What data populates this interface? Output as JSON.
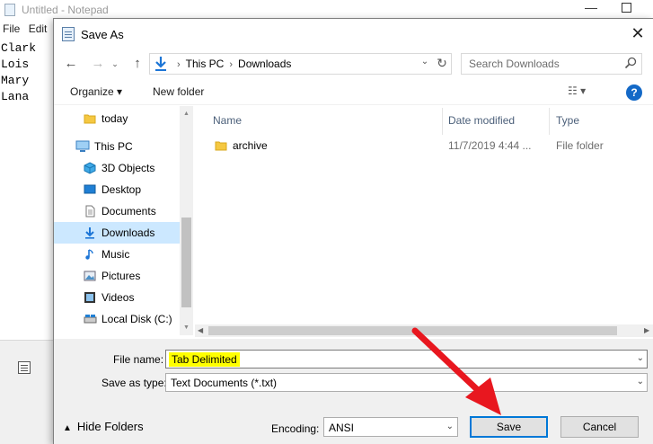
{
  "notepad": {
    "title": "Untitled - Notepad",
    "menu": [
      "File",
      "Edit"
    ],
    "content_lines": [
      "Clark",
      "Lois",
      "Mary",
      "Lana"
    ],
    "min_glyph": "—"
  },
  "dialog": {
    "title": "Save As",
    "close_glyph": "✕",
    "nav": {
      "back_glyph": "←",
      "forward_glyph": "→",
      "recent_glyph": "⌄",
      "up_glyph": "↑"
    },
    "address": {
      "crumbs": [
        "This PC",
        "Downloads"
      ],
      "separator": "›",
      "drop_glyph": "⌄",
      "refresh_glyph": "↻"
    },
    "search": {
      "placeholder": "Search Downloads",
      "value": ""
    },
    "toolbar": {
      "organize_label": "Organize ▾",
      "new_folder_label": "New folder",
      "view_glyph": "☷ ▾",
      "help_glyph": "?"
    },
    "navpane": {
      "items": [
        {
          "label": "today",
          "icon": "folder-icon"
        },
        {
          "label": "This PC",
          "icon": "computer-icon"
        },
        {
          "label": "3D Objects",
          "icon": "cube-icon"
        },
        {
          "label": "Desktop",
          "icon": "desktop-icon"
        },
        {
          "label": "Documents",
          "icon": "document-icon"
        },
        {
          "label": "Downloads",
          "icon": "download-icon",
          "selected": true
        },
        {
          "label": "Music",
          "icon": "music-icon"
        },
        {
          "label": "Pictures",
          "icon": "picture-icon"
        },
        {
          "label": "Videos",
          "icon": "video-icon"
        },
        {
          "label": "Local Disk (C:)",
          "icon": "disk-icon"
        }
      ]
    },
    "filelist": {
      "columns": [
        "Name",
        "Date modified",
        "Type"
      ],
      "rows": [
        {
          "name": "archive",
          "date": "11/7/2019 4:44 ...",
          "type": "File folder",
          "icon": "folder-icon"
        }
      ]
    },
    "filename": {
      "label": "File name:",
      "value": "Tab Delimited"
    },
    "save_as_type": {
      "label": "Save as type:",
      "value": "Text Documents (*.txt)"
    },
    "hide_folders_label": "Hide Folders",
    "encoding": {
      "label": "Encoding:",
      "value": "ANSI"
    },
    "save_label": "Save",
    "cancel_label": "Cancel"
  },
  "colors": {
    "accent": "#0078d7",
    "selection": "#cce8ff",
    "highlight": "#ffff00",
    "arrow": "#e8171f",
    "folder": "#f5c842"
  }
}
